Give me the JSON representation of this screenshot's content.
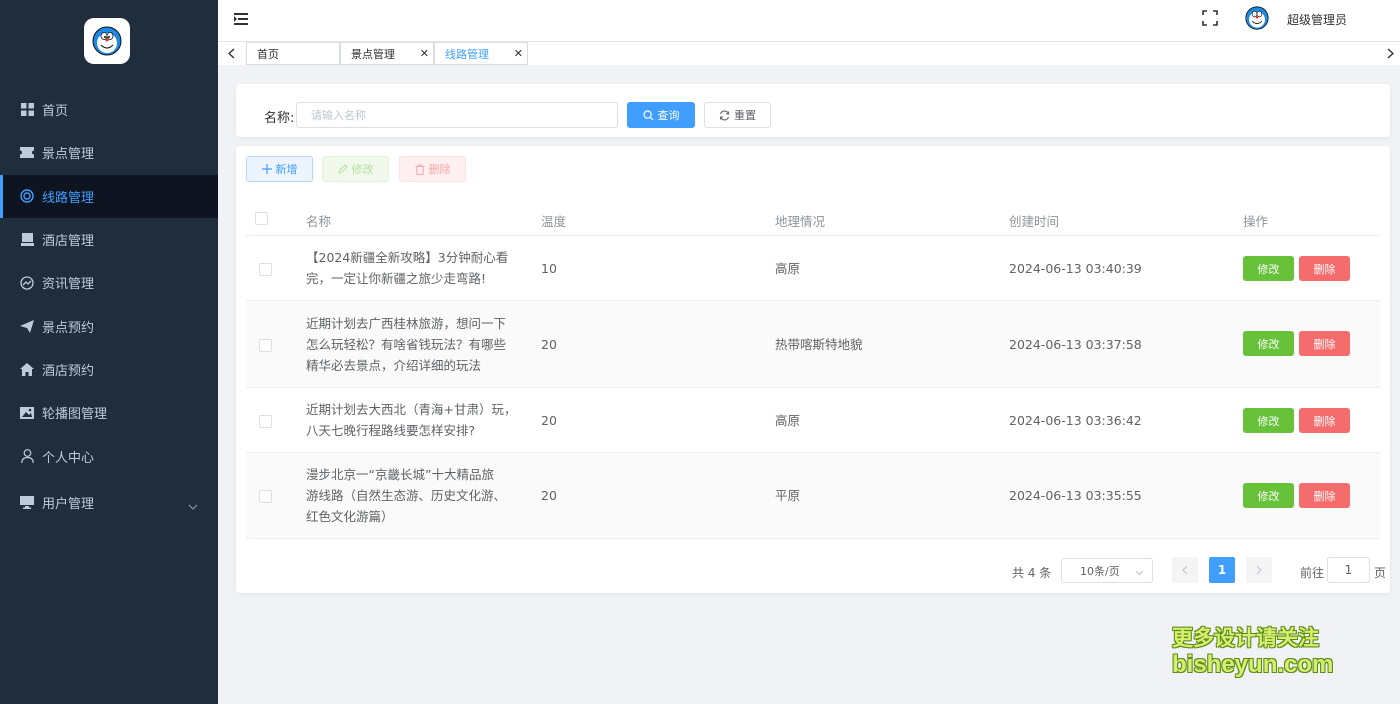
{
  "sidebar": {
    "items": [
      {
        "label": "首页",
        "icon": "grid-icon"
      },
      {
        "label": "景点管理",
        "icon": "ticket-icon"
      },
      {
        "label": "线路管理",
        "icon": "route-icon"
      },
      {
        "label": "酒店管理",
        "icon": "hotel-icon"
      },
      {
        "label": "资讯管理",
        "icon": "dashboard-icon"
      },
      {
        "label": "景点预约",
        "icon": "send-icon"
      },
      {
        "label": "酒店预约",
        "icon": "home-icon"
      },
      {
        "label": "轮播图管理",
        "icon": "picture-icon"
      },
      {
        "label": "个人中心",
        "icon": "user-icon"
      },
      {
        "label": "用户管理",
        "icon": "monitor-icon"
      }
    ]
  },
  "header": {
    "username": "超级管理员"
  },
  "tags": [
    {
      "label": "首页"
    },
    {
      "label": "景点管理"
    },
    {
      "label": "线路管理"
    }
  ],
  "search": {
    "label": "名称:",
    "placeholder": "请输入名称",
    "query_label": "查询",
    "reset_label": "重置"
  },
  "toolbar": {
    "add_label": "新增",
    "edit_label": "修改",
    "delete_label": "删除"
  },
  "table": {
    "columns": [
      "名称",
      "温度",
      "地理情况",
      "创建时间",
      "操作"
    ],
    "rows": [
      {
        "name_lines": [
          "【2024新疆全新攻略】3分钟耐心看",
          "完，一定让你新疆之旅少走弯路!"
        ],
        "temp": "10",
        "geo": "高原",
        "created": "2024-06-13 03:40:39"
      },
      {
        "name_lines": [
          "近期计划去广西桂林旅游，想问一下",
          "怎么玩轻松？有啥省钱玩法？有哪些",
          "精华必去景点，介绍详细的玩法"
        ],
        "temp": "20",
        "geo": "热带喀斯特地貌",
        "created": "2024-06-13 03:37:58"
      },
      {
        "name_lines": [
          "近期计划去大西北（青海+甘肃）玩，",
          "八天七晚行程路线要怎样安排?"
        ],
        "temp": "20",
        "geo": "高原",
        "created": "2024-06-13 03:36:42"
      },
      {
        "name_lines": [
          "漫步北京一“京畿长城”十大精品旅",
          "游线路（自然生态游、历史文化游、",
          "红色文化游篇）"
        ],
        "temp": "20",
        "geo": "平原",
        "created": "2024-06-13 03:35:55"
      }
    ],
    "row_edit_label": "修改",
    "row_delete_label": "删除"
  },
  "pagination": {
    "total_text": "共 4 条",
    "page_size": "10条/页",
    "current_page": "1",
    "goto_label": "前往",
    "goto_value": "1",
    "goto_suffix": "页"
  },
  "watermark": {
    "line1": "更多设计请关注",
    "line2": "bisheyun.com"
  },
  "colors": {
    "sidebar_bg": "#1f2d3d",
    "primary": "#409eff",
    "success": "#67c23a",
    "danger": "#f56c6c"
  }
}
